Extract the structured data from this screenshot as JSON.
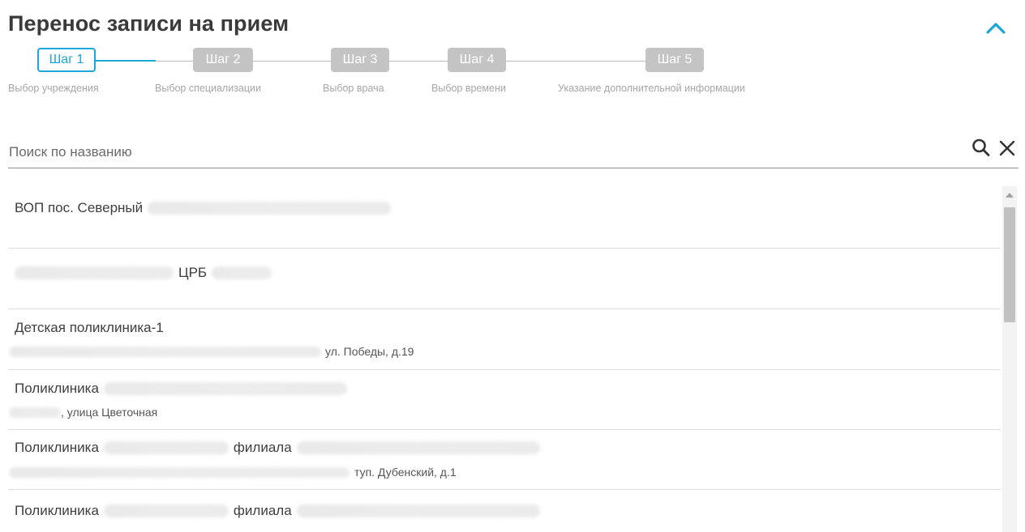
{
  "header": {
    "title": "Перенос записи на прием",
    "collapse_icon": "chevron-up-icon"
  },
  "stepper": {
    "active_color": "#1ca6d9",
    "inactive_color": "#c4c4c4",
    "steps": [
      {
        "label": "Шаг 1",
        "caption": "Выбор учреждения",
        "active": true
      },
      {
        "label": "Шаг 2",
        "caption": "Выбор специализации",
        "active": false
      },
      {
        "label": "Шаг 3",
        "caption": "Выбор врача",
        "active": false
      },
      {
        "label": "Шаг 4",
        "caption": "Выбор времени",
        "active": false
      },
      {
        "label": "Шаг 5",
        "caption": "Указание дополнительной информации",
        "active": false
      }
    ]
  },
  "search": {
    "placeholder": "Поиск по названию",
    "value": "",
    "search_icon": "search-icon",
    "clear_icon": "close-icon"
  },
  "list": {
    "items": [
      {
        "title": "ВОП пос. Северный",
        "address": ""
      },
      {
        "title": "ЦРБ",
        "address": ""
      },
      {
        "title": "Детская поликлиника-1",
        "address": "ул. Победы, д.19"
      },
      {
        "title": "Поликлиника",
        "address": ", улица Цветочная"
      },
      {
        "title": "Поликлиника",
        "title_suffix": "филиала",
        "address": "туп. Дубенский, д.1"
      },
      {
        "title": "Поликлиника",
        "title_suffix": "филиала",
        "address": ""
      }
    ]
  },
  "scrollbar": {
    "position_fraction": 0.0,
    "visible_fraction": 0.33
  }
}
